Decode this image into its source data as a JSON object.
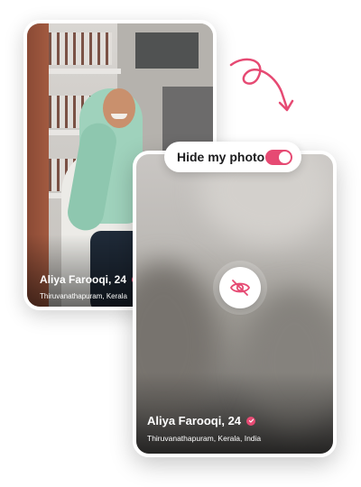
{
  "theme": {
    "accent": "#e64a73",
    "card_border": "#ffffff"
  },
  "profile_card": {
    "name_age": "Aliya Farooqi, 24",
    "location": "Thiruvanathapuram, Kerala",
    "verified_icon": "verified-check-icon"
  },
  "hidden_card": {
    "name_age": "Aliya Farooqi, 24",
    "location": "Thiruvanathapuram, Kerala, India",
    "verified_icon": "verified-check-icon",
    "center_icon": "eye-off-icon"
  },
  "hide_photo_toggle": {
    "label": "Hide my photo",
    "on": true
  },
  "decor": {
    "arrow_icon": "curly-arrow-icon"
  }
}
